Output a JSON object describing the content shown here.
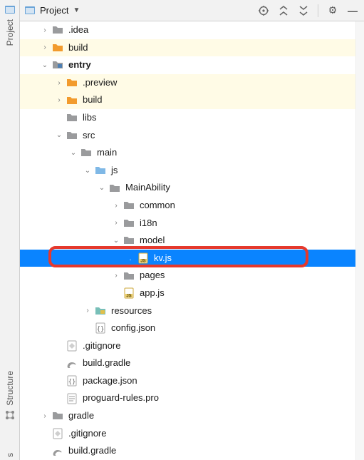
{
  "sideTabs": {
    "project": "Project",
    "structure": "Structure"
  },
  "topbar": {
    "scope": "Project"
  },
  "icons": {
    "folder_gray": "folder",
    "folder_orange": "folder",
    "folder_blue": "folder",
    "folder_teal": "folder",
    "js_file": "JS",
    "json_file": "{}",
    "gitignore": "git",
    "gradle_file": "gradle",
    "proguard_file": "pro"
  },
  "tree": {
    "idea": ".idea",
    "build_root": "build",
    "entry": "entry",
    "preview": ".preview",
    "build_entry": "build",
    "libs": "libs",
    "src": "src",
    "main": "main",
    "js": "js",
    "mainability": "MainAbility",
    "common": "common",
    "i18n": "i18n",
    "model": "model",
    "kvjs": "kv.js",
    "pages": "pages",
    "appjs": "app.js",
    "resources": "resources",
    "configjson": "config.json",
    "gitignore_entry": ".gitignore",
    "build_gradle_entry": "build.gradle",
    "packagejson": "package.json",
    "proguard": "proguard-rules.pro",
    "gradle_root": "gradle",
    "gitignore_root": ".gitignore",
    "build_gradle_root": "build.gradle"
  }
}
